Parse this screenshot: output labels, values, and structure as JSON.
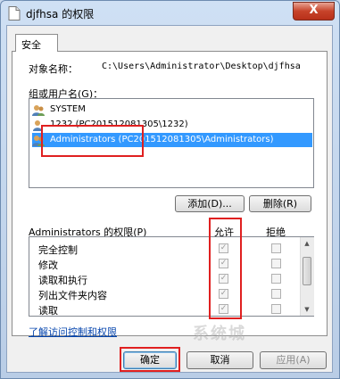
{
  "window": {
    "title": "djfhsa 的权限",
    "close_label": "X"
  },
  "tabs": [
    {
      "label": "安全"
    }
  ],
  "object": {
    "label": "对象名称：",
    "value": "C:\\Users\\Administrator\\Desktop\\djfhsa"
  },
  "groups": {
    "label": "组或用户名(G)：",
    "items": [
      {
        "label": "SYSTEM"
      },
      {
        "label": "1232 (PC201512081305\\1232)"
      },
      {
        "label": "Administrators (PC201512081305\\Administrators)"
      }
    ]
  },
  "group_buttons": {
    "add": "添加(D)...",
    "remove": "删除(R)"
  },
  "permissions": {
    "label": "Administrators 的权限(P)",
    "allow_header": "允许",
    "deny_header": "拒绝",
    "rows": [
      {
        "name": "完全控制",
        "allow": true,
        "deny": false
      },
      {
        "name": "修改",
        "allow": true,
        "deny": false
      },
      {
        "name": "读取和执行",
        "allow": true,
        "deny": false
      },
      {
        "name": "列出文件夹内容",
        "allow": true,
        "deny": false
      },
      {
        "name": "读取",
        "allow": true,
        "deny": false
      }
    ]
  },
  "link": "了解访问控制和权限",
  "footer": {
    "ok": "确定",
    "cancel": "取消",
    "apply": "应用(A)"
  },
  "watermark": "系统城"
}
